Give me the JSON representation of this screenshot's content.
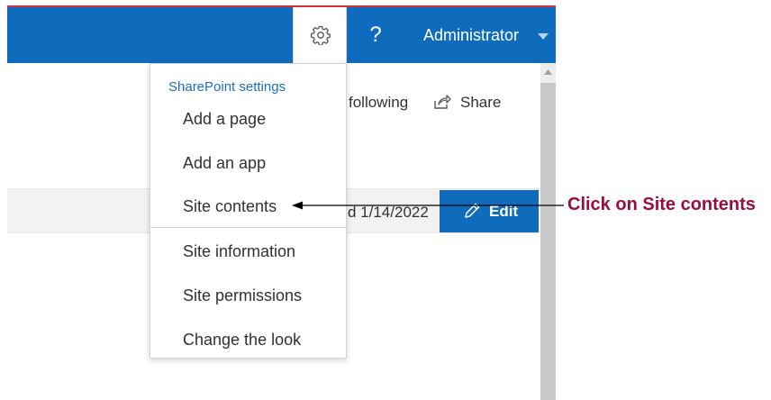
{
  "suite_bar": {
    "help_glyph": "?",
    "user_name": "Administrator",
    "colors": {
      "bar": "#0f6cbd",
      "top_accent": "#d13438"
    }
  },
  "page": {
    "following_label": "following",
    "share_label": "Share",
    "modified_text": "d 1/14/2022",
    "edit_label": "Edit"
  },
  "settings_menu": {
    "heading": "SharePoint settings",
    "items": [
      {
        "label": "Add a page"
      },
      {
        "label": "Add an app"
      },
      {
        "label": "Site contents"
      },
      {
        "label": "Site information"
      },
      {
        "label": "Site permissions"
      },
      {
        "label": "Change the look"
      }
    ]
  },
  "annotation": {
    "text": "Click on Site contents",
    "color": "#9b0e3b"
  }
}
